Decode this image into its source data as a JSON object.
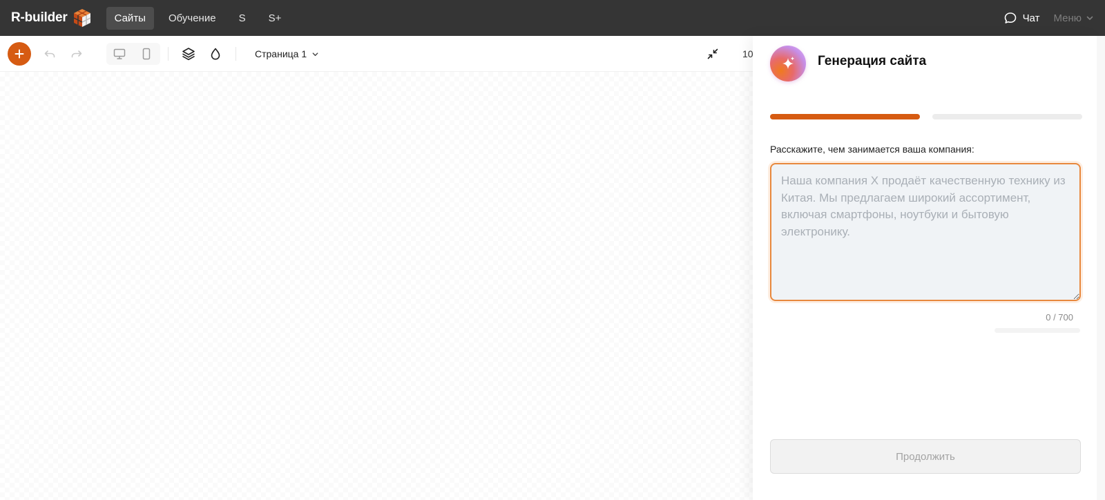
{
  "app": {
    "logo_text": "R-builder",
    "nav": [
      {
        "label": "Сайты",
        "active": true
      },
      {
        "label": "Обучение",
        "active": false
      },
      {
        "label": "S",
        "active": false
      },
      {
        "label": "S+",
        "active": false
      }
    ],
    "chat_label": "Чат",
    "menu_label": "Меню"
  },
  "toolbar": {
    "page_select": "Страница 1",
    "zoom_text": "10"
  },
  "panel": {
    "title": "Генерация сайта",
    "progress_steps": 2,
    "progress_current": 1,
    "prompt_label": "Расскажите, чем занимается ваша компания:",
    "prompt_value": "",
    "prompt_placeholder": "Наша компания X продаёт качественную технику из Китая. Мы предлагаем широкий ассортимент, включая смартфоны, ноутбуки и бытовую электронику.",
    "counter": "0 / 700",
    "continue_label": "Продолжить"
  },
  "colors": {
    "accent": "#d65b12",
    "topbar": "#353535",
    "progress_active": "#d65b12",
    "progress_inactive": "#ececec"
  },
  "icons": [
    "logo-cube-icon",
    "chat-icon",
    "chevron-down-icon",
    "plus-icon",
    "undo-icon",
    "redo-icon",
    "desktop-icon",
    "mobile-icon",
    "layers-icon",
    "droplet-icon",
    "collapse-icon",
    "sparkle-icon"
  ]
}
